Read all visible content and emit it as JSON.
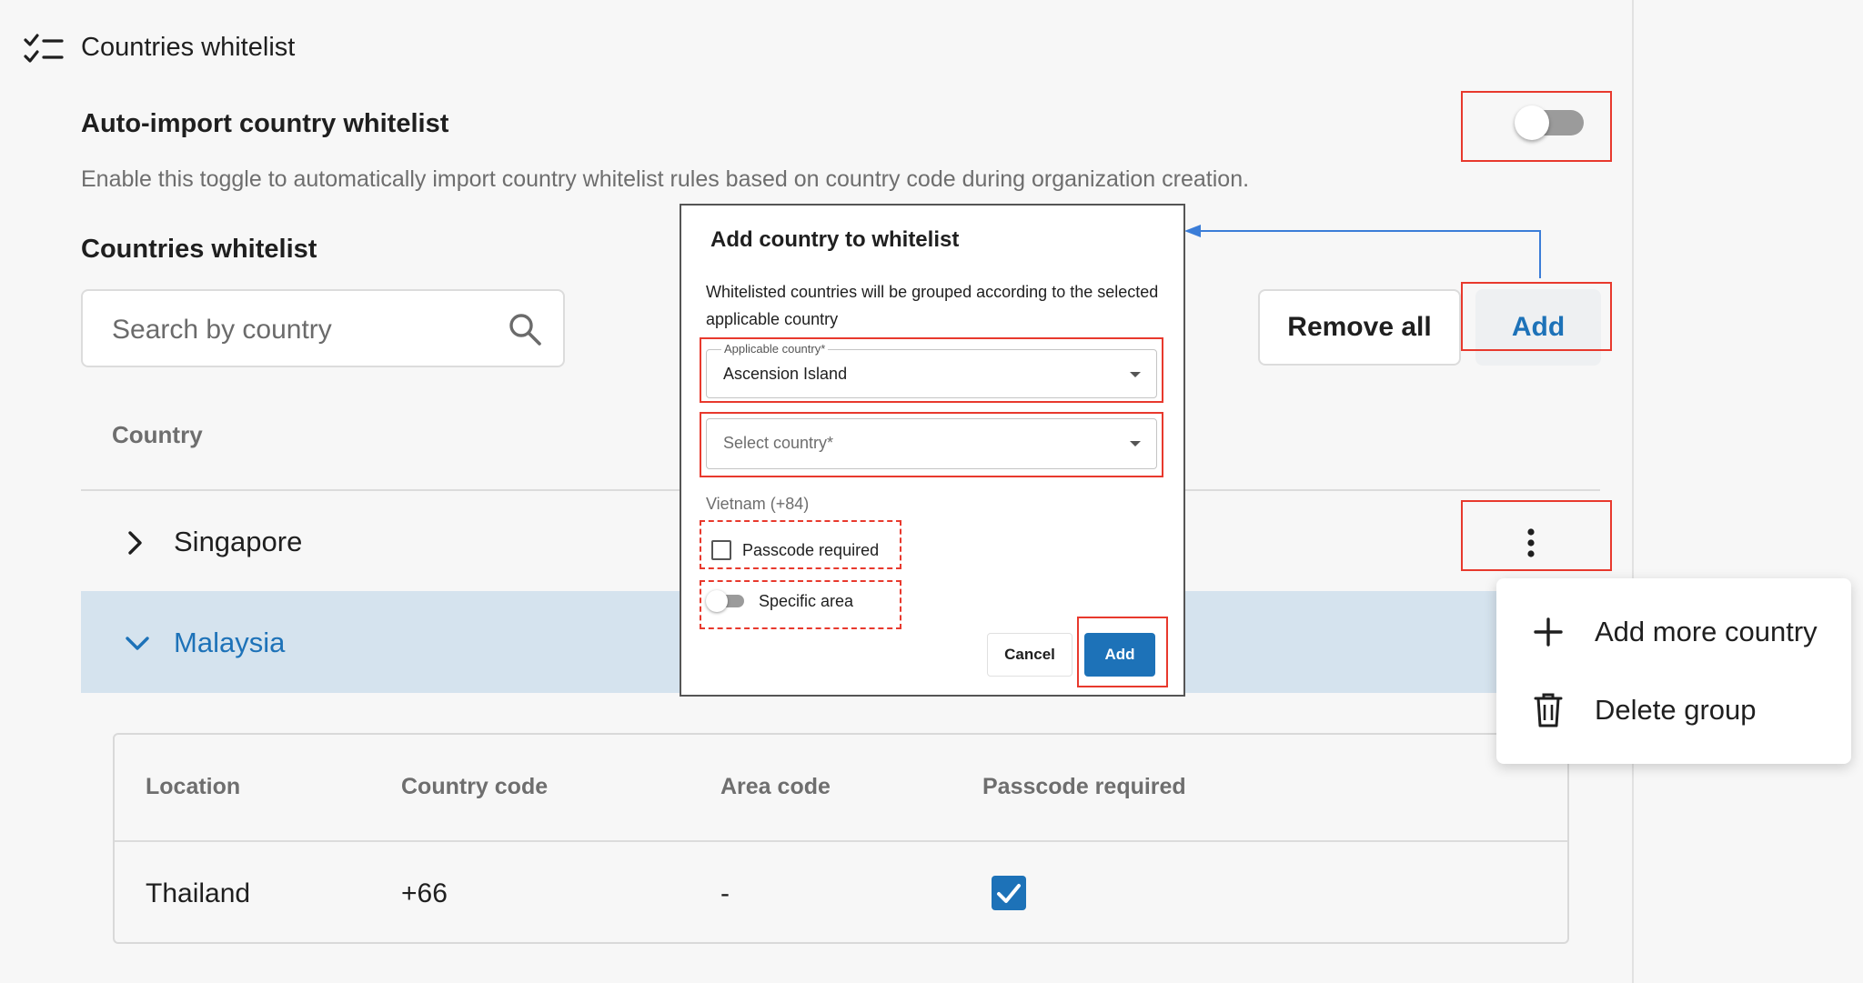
{
  "section": {
    "title": "Countries whitelist",
    "icon": "checklist-icon"
  },
  "auto_import": {
    "title": "Auto-import country whitelist",
    "description": "Enable this toggle to automatically import country whitelist rules based on country code during organization creation.",
    "enabled": false
  },
  "whitelist": {
    "title": "Countries whitelist",
    "search_placeholder": "Search by country",
    "remove_all_label": "Remove all",
    "add_label": "Add",
    "column_country": "Country",
    "groups": [
      {
        "name": "Singapore",
        "expanded": false
      },
      {
        "name": "Malaysia",
        "expanded": true
      }
    ],
    "inner_table": {
      "headers": [
        "Location",
        "Country code",
        "Area code",
        "Passcode required"
      ],
      "rows": [
        {
          "location": "Thailand",
          "country_code": "+66",
          "area_code": "-",
          "passcode_required": true
        }
      ]
    }
  },
  "context_menu": {
    "items": [
      {
        "label": "Add more country",
        "icon": "plus-icon"
      },
      {
        "label": "Delete group",
        "icon": "trash-icon"
      }
    ]
  },
  "dialog": {
    "title": "Add country to whitelist",
    "description": "Whitelisted countries will be grouped according to the selected applicable country",
    "applicable_country_label": "Applicable country*",
    "applicable_country_value": "Ascension Island",
    "select_country_placeholder": "Select country*",
    "group_label": "Vietnam (+84)",
    "passcode_label": "Passcode required",
    "passcode_checked": false,
    "specific_area_label": "Specific area",
    "specific_area_on": false,
    "cancel_label": "Cancel",
    "add_label": "Add"
  },
  "colors": {
    "accent": "#1d72b8",
    "annotation": "#e8392d",
    "selected_row": "#d5e3ee",
    "arrow": "#3b7dd8"
  }
}
